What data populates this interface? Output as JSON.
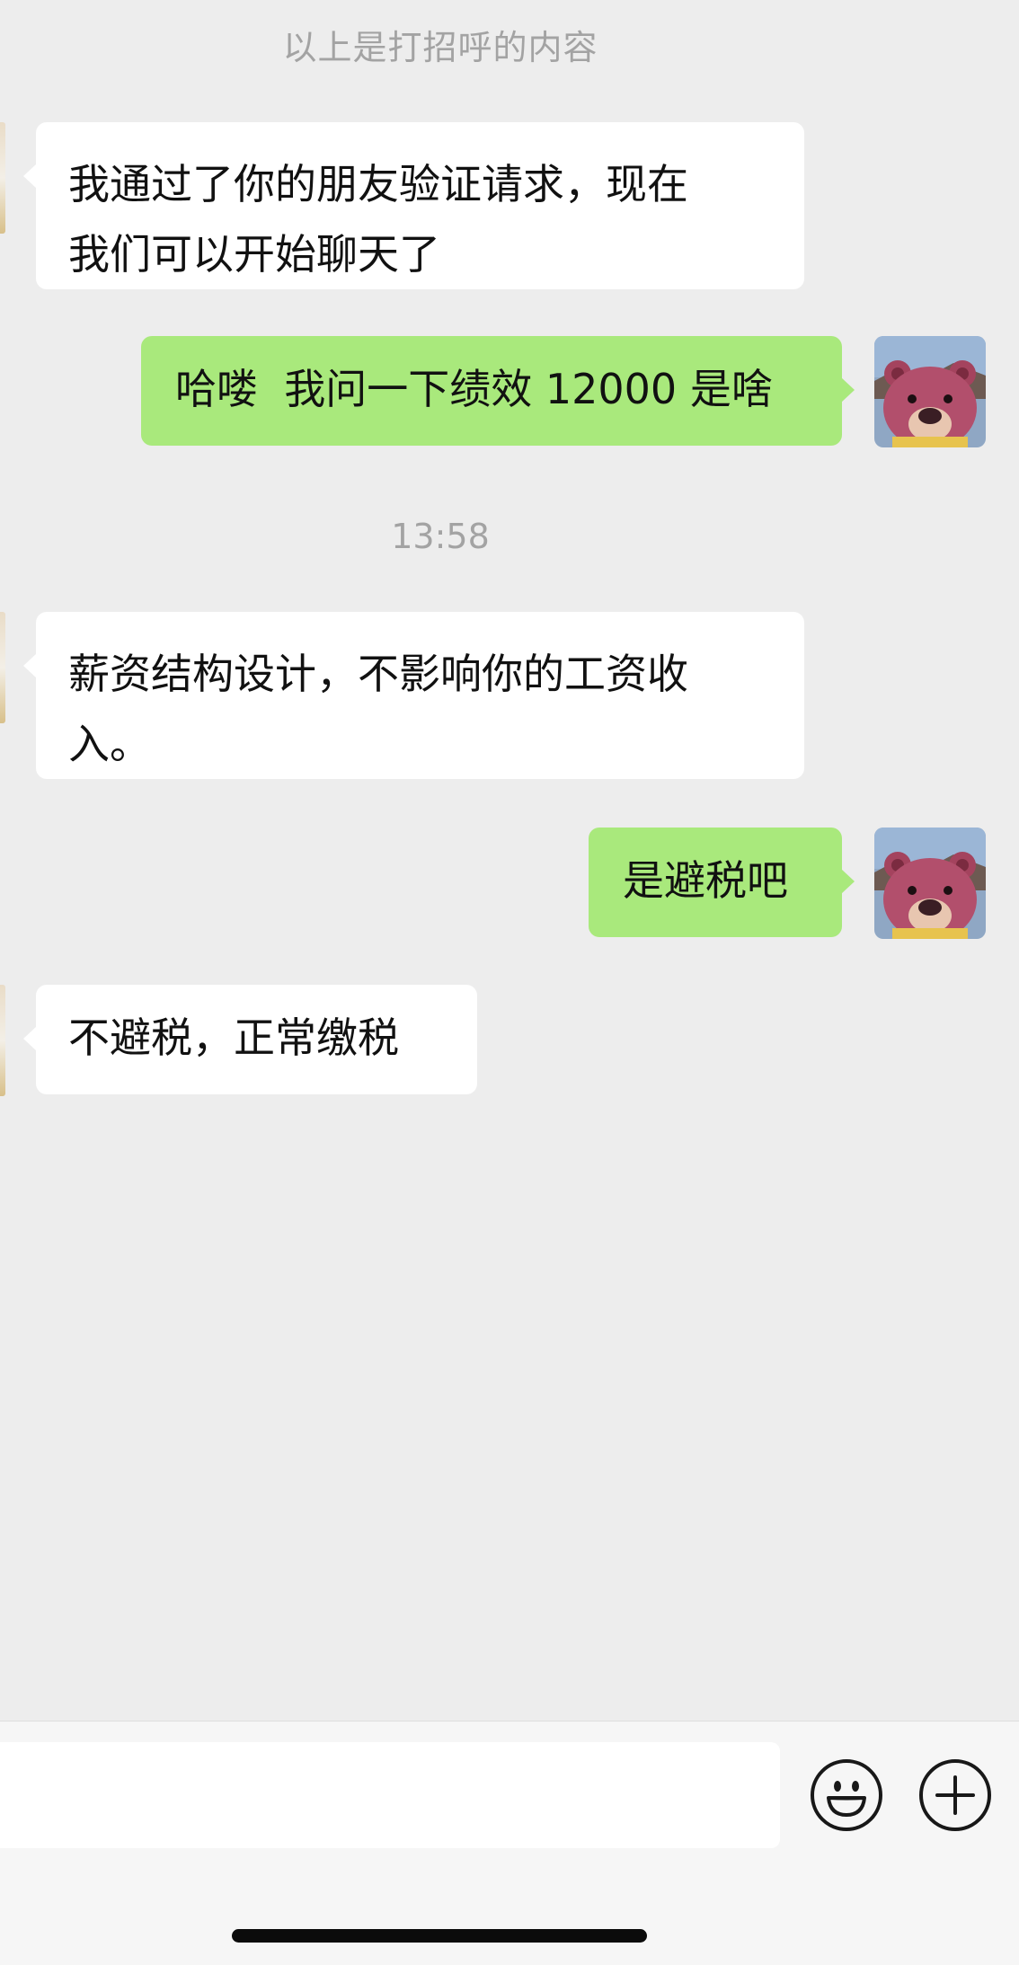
{
  "chat": {
    "system_note": "以上是打招呼的内容",
    "timestamp": "13:58",
    "messages": [
      {
        "side": "left",
        "text": "我通过了你的朋友验证请求，现在\n我们可以开始聊天了"
      },
      {
        "side": "right",
        "text": "哈喽  我问一下绩效 12000 是啥"
      },
      {
        "side": "left",
        "text": "薪资结构设计，不影响你的工资收\n入。"
      },
      {
        "side": "right",
        "text": "是避税吧"
      },
      {
        "side": "left",
        "text": "不避税，正常缴税"
      }
    ]
  },
  "input_bar": {
    "text_value": "",
    "emoji_icon": "smiley-face-icon",
    "more_icon": "plus-circle-icon"
  },
  "colors": {
    "background": "#ededed",
    "incoming_bubble": "#ffffff",
    "outgoing_bubble": "#a9e97c",
    "meta_text": "#a3a3a3",
    "input_bar": "#f6f6f6"
  },
  "avatar_icon": "pink-bear-plush-avatar"
}
